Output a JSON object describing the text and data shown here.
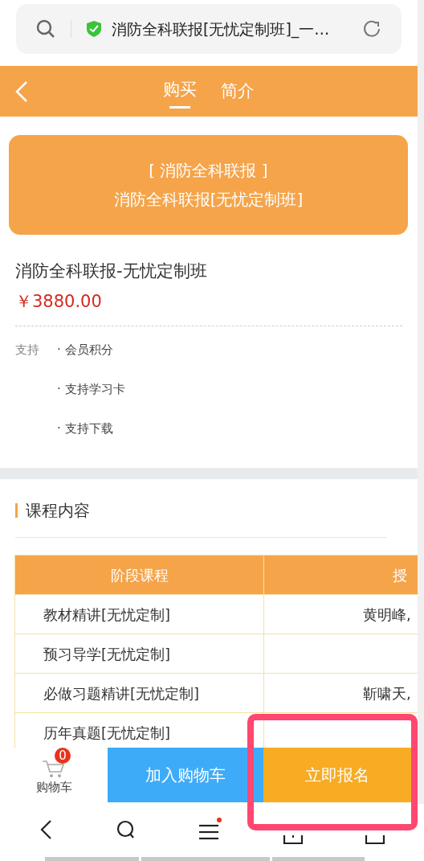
{
  "address_bar": {
    "title": "消防全科联报[无忧定制班]_一…"
  },
  "header": {
    "tabs": [
      {
        "label": "购买",
        "selected": true
      },
      {
        "label": "简介",
        "selected": false
      }
    ]
  },
  "banner": {
    "line_1": "[ 消防全科联报 ]",
    "line_2": "消防全科联报[无忧定制班]"
  },
  "product": {
    "name": "消防全科联报-无忧定制班",
    "price": "￥3880.00"
  },
  "support": {
    "label": "支持",
    "items": [
      "· 会员积分",
      "· 支持学习卡",
      "· 支持下载"
    ]
  },
  "course_section": {
    "title": "课程内容"
  },
  "table": {
    "columns": [
      "阶段课程",
      "授"
    ],
    "rows": [
      [
        "教材精讲[无忧定制]",
        "黄明峰,"
      ],
      [
        "预习导学[无忧定制]",
        ""
      ],
      [
        "必做习题精讲[无忧定制]",
        "靳啸天,"
      ],
      [
        "历年真题[无忧定制]",
        ""
      ]
    ]
  },
  "action_bar": {
    "cart_label": "购物车",
    "cart_count": "0",
    "add_to_cart": "加入购物车",
    "enroll": "立即报名"
  }
}
